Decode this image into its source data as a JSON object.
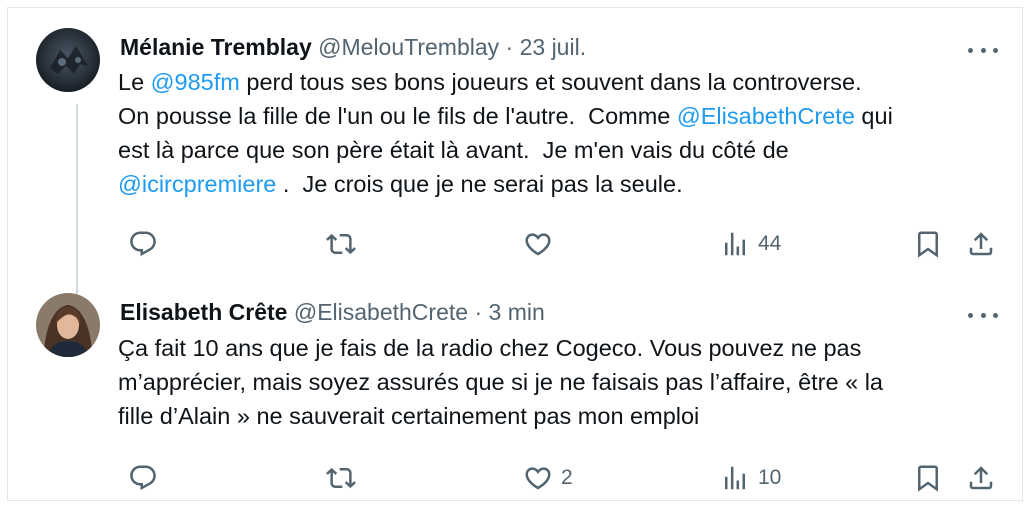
{
  "tweets": [
    {
      "author_name": "Mélanie Tremblay",
      "author_handle": "@MelouTremblay",
      "separator": "·",
      "time": "23 juil.",
      "lines": [
        [
          {
            "t": "Le "
          },
          {
            "t": "@985fm",
            "m": true
          },
          {
            "t": " perd tous ses bons joueurs et souvent dans la controverse."
          }
        ],
        [
          {
            "t": "On pousse la fille de l'un ou le fils de l'autre.  Comme "
          },
          {
            "t": "@ElisabethCrete",
            "m": true
          },
          {
            "t": " qui"
          }
        ],
        [
          {
            "t": "est là parce que son père était là avant.  Je m'en vais du côté de"
          }
        ],
        [
          {
            "t": "@icircpremiere",
            "m": true
          },
          {
            "t": " .  Je crois que je ne serai pas la seule."
          }
        ]
      ],
      "stats": {
        "replies": "",
        "reposts": "",
        "likes": "",
        "views": "44"
      }
    },
    {
      "author_name": "Elisabeth Crête",
      "author_handle": "@ElisabethCrete",
      "separator": "·",
      "time": "3 min",
      "lines": [
        [
          {
            "t": "Ça fait 10 ans que je fais de la radio chez Cogeco. Vous pouvez ne pas"
          }
        ],
        [
          {
            "t": "m’apprécier, mais soyez assurés que si je ne faisais pas l’affaire, être « la"
          }
        ],
        [
          {
            "t": "fille d’Alain » ne sauverait certainement pas mon emploi"
          }
        ]
      ],
      "stats": {
        "replies": "",
        "reposts": "",
        "likes": "2",
        "views": "10"
      }
    }
  ],
  "icons": {
    "reply": "reply-icon",
    "repost": "repost-icon",
    "like": "like-icon",
    "views": "views-icon",
    "bookmark": "bookmark-icon",
    "share": "share-icon",
    "more": "more-icon"
  },
  "colors": {
    "mention": "#1d9bf0",
    "meta": "#536471",
    "thread_line": "#cfd9de"
  }
}
